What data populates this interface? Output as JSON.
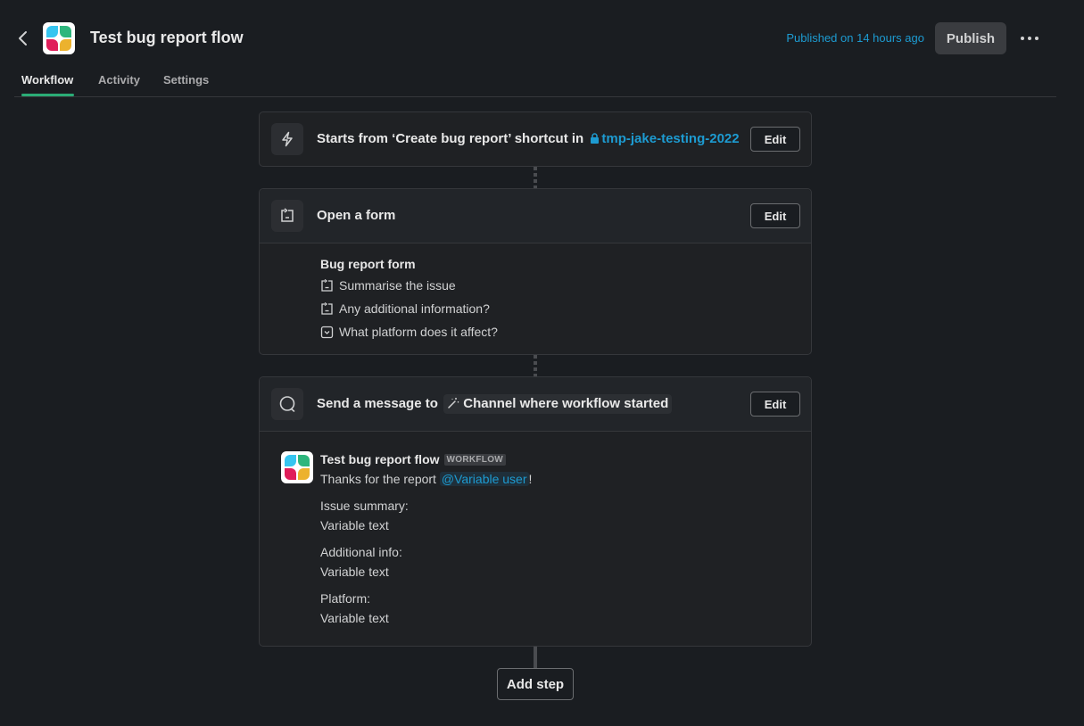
{
  "header": {
    "title": "Test bug report flow",
    "published_text": "Published on 14 hours ago",
    "publish_label": "Publish",
    "logo_colors": [
      "#36c5f0",
      "#2eb67d",
      "#e01e5a",
      "#ecb22e"
    ]
  },
  "tabs": [
    {
      "label": "Workflow",
      "active": true
    },
    {
      "label": "Activity",
      "active": false
    },
    {
      "label": "Settings",
      "active": false
    }
  ],
  "steps": {
    "trigger": {
      "icon": "lightning-icon",
      "text_prefix": "Starts from ‘Create bug report’ shortcut in",
      "channel": "tmp-jake-testing-2022",
      "edit_label": "Edit"
    },
    "form": {
      "icon": "form-icon",
      "title": "Open a form",
      "edit_label": "Edit",
      "form_name": "Bug report form",
      "fields": [
        {
          "label": "Summarise the issue",
          "icon": "text-field-icon"
        },
        {
          "label": "Any additional information?",
          "icon": "text-field-icon"
        },
        {
          "label": "What platform does it affect?",
          "icon": "dropdown-field-icon"
        }
      ]
    },
    "message": {
      "icon": "message-bubble-icon",
      "title_prefix": "Send a message to",
      "target": "Channel where workflow started",
      "edit_label": "Edit",
      "author": "Test bug report flow",
      "badge": "WORKFLOW",
      "thanks_prefix": "Thanks for the report",
      "mention": "@Variable user",
      "thanks_suffix": "!",
      "sections": [
        {
          "label": "Issue summary:",
          "value": "Variable text"
        },
        {
          "label": "Additional info:",
          "value": "Variable text"
        },
        {
          "label": "Platform:",
          "value": "Variable text"
        }
      ]
    }
  },
  "add_step_label": "Add step"
}
